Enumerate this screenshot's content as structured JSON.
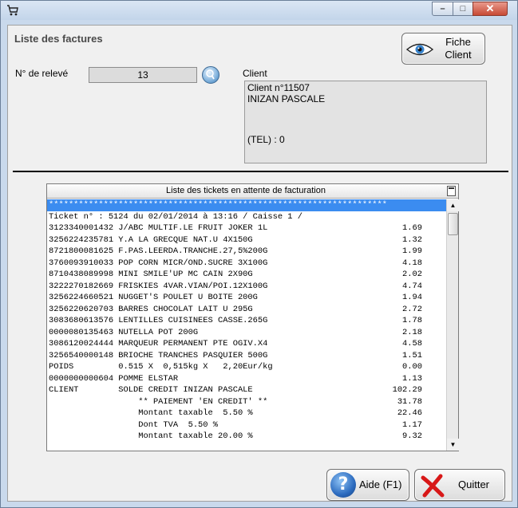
{
  "window": {
    "icon": "cart-icon",
    "controls": {
      "minimize": "–",
      "maximize": "□",
      "close": "✕"
    }
  },
  "header": {
    "title": "Liste des factures",
    "fiche_client_line1": "Fiche",
    "fiche_client_line2": "Client"
  },
  "releve": {
    "label": "N° de relevé",
    "value": "13"
  },
  "client": {
    "label": "Client",
    "line1": "Client n°11507",
    "line2": "INIZAN PASCALE",
    "tel": "(TEL) : 0"
  },
  "tickets": {
    "header": "Liste des tickets en attente de facturation",
    "rows": [
      {
        "text": "********************************************************************",
        "amount": "",
        "selected": true
      },
      {
        "text": "Ticket n° : 5124 du 02/01/2014 à 13:16 / Caisse 1 /",
        "amount": ""
      },
      {
        "text": "3123340001432 J/ABC MULTIF.LE FRUIT JOKER 1L",
        "amount": "1.69"
      },
      {
        "text": "3256224235781 Y.A LA GRECQUE NAT.U 4X150G",
        "amount": "1.32"
      },
      {
        "text": "8721800081625 F.PAS.LEERDA.TRANCHE.27,5%200G",
        "amount": "1.99"
      },
      {
        "text": "3760093910033 POP CORN MICR/OND.SUCRE 3X100G",
        "amount": "4.18"
      },
      {
        "text": "8710438089998 MINI SMILE'UP MC CAIN 2X90G",
        "amount": "2.02"
      },
      {
        "text": "3222270182669 FRISKIES 4VAR.VIAN/POI.12X100G",
        "amount": "4.74"
      },
      {
        "text": "3256224660521 NUGGET'S POULET U BOITE 200G",
        "amount": "1.94"
      },
      {
        "text": "3256220620703 BARRES CHOCOLAT LAIT U 295G",
        "amount": "2.72"
      },
      {
        "text": "3083680613576 LENTILLES CUISINEES CASSE.265G",
        "amount": "1.78"
      },
      {
        "text": "0000080135463 NUTELLA POT 200G",
        "amount": "2.18"
      },
      {
        "text": "3086120024444 MARQUEUR PERMANENT PTE OGIV.X4",
        "amount": "4.58"
      },
      {
        "text": "3256540000148 BRIOCHE TRANCHES PASQUIER 500G",
        "amount": "1.51"
      },
      {
        "text": "POIDS         0.515 X  0,515kg X   2,20Eur/kg",
        "amount": "0.00"
      },
      {
        "text": "0000000000604 POMME ELSTAR",
        "amount": "1.13"
      },
      {
        "text": "CLIENT        SOLDE CREDIT INIZAN PASCALE",
        "amount": "102.29"
      },
      {
        "text": "                  ** PAIEMENT 'EN CREDIT' **",
        "amount": "31.78"
      },
      {
        "text": "                  Montant taxable  5.50 %",
        "amount": "22.46"
      },
      {
        "text": "                  Dont TVA  5.50 %",
        "amount": "1.17"
      },
      {
        "text": "                  Montant taxable 20.00 %",
        "amount": "9.32"
      }
    ]
  },
  "footer": {
    "aide_label": "Aide (F1)",
    "quitter_label": "Quitter"
  }
}
